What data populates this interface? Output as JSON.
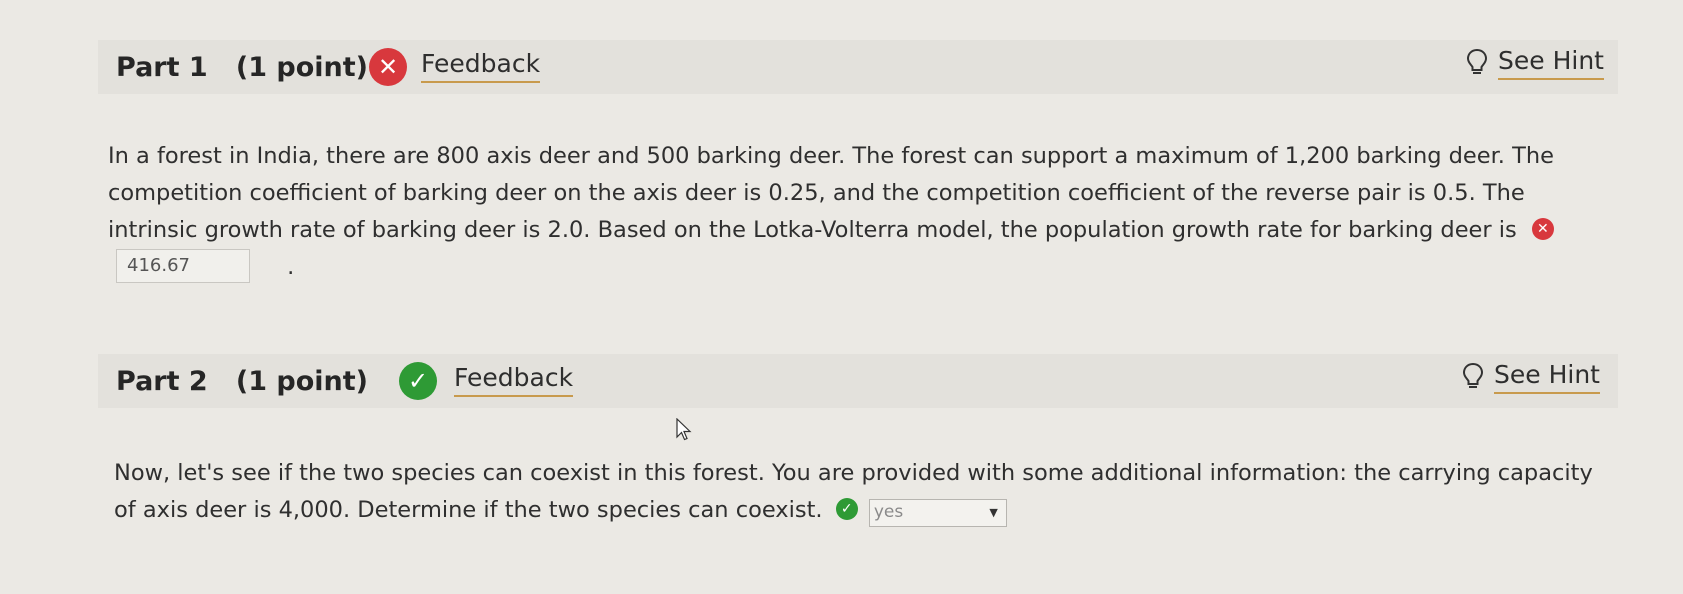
{
  "part1": {
    "title": "Part 1   (1 point)",
    "feedback_label": "Feedback",
    "status": "incorrect",
    "status_icon": "x-circle-icon",
    "hint_label": "See Hint",
    "hint_icon": "lightbulb-icon",
    "question_text": "In a forest in India, there are 800 axis deer and 500 barking deer. The forest can support a maximum of 1,200 barking deer. The competition coefficient of barking deer on the axis deer is 0.25, and the competition coefficient of the reverse pair is 0.5. The intrinsic growth rate of barking deer is 2.0. Based on the Lotka-Volterra model, the population growth rate for barking deer is",
    "answer_value": "416.67",
    "trailing": "."
  },
  "part2": {
    "title": "Part 2   (1 point)",
    "feedback_label": "Feedback",
    "status": "correct",
    "status_icon": "check-circle-icon",
    "hint_label": "See Hint",
    "hint_icon": "lightbulb-icon",
    "question_text": "Now, let's see if the two species can coexist in this forest. You are provided with some additional information: the carrying capacity of axis deer is 4,000. Determine if the two species can coexist.",
    "selected_option": "yes"
  },
  "colors": {
    "incorrect": "#d8383d",
    "correct": "#2e9a35",
    "link_underline": "#c89a4d",
    "background": "#ebe9e4"
  }
}
